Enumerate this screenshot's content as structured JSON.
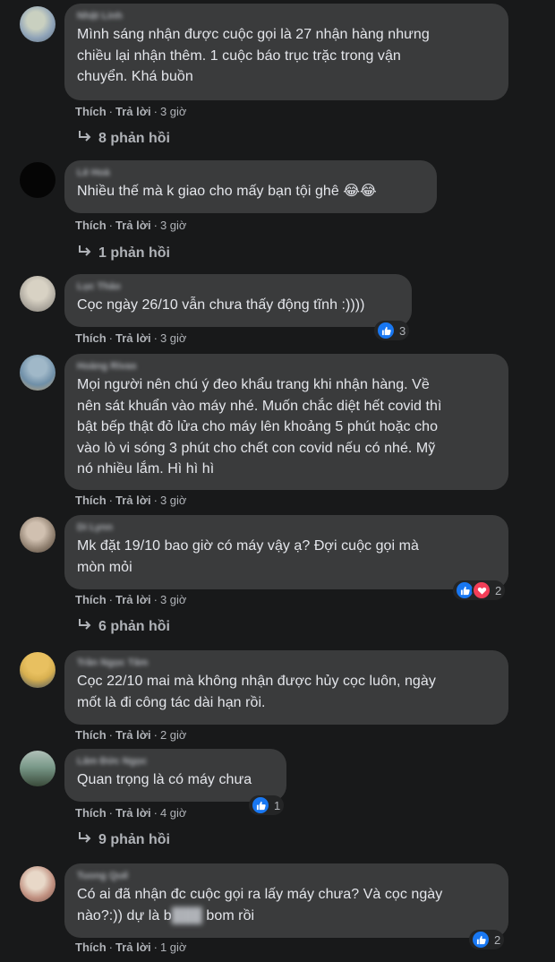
{
  "comments": [
    {
      "author": "Nhật Linh",
      "text": "Mình sáng nhận được cuộc gọi là 27 nhận hàng nhưng\nchiều lại nhận thêm. 1 cuộc báo trục trặc trong vận\nchuyển. Khá buồn",
      "like": "Thích",
      "reply": "Trả lời",
      "time": "3 giờ",
      "replies": "8 phản hồi",
      "avatar_colors": [
        "#8fa3b8",
        "#c9d0c0"
      ]
    },
    {
      "author": "Lê Hoà",
      "text": "Nhiều thế mà k giao cho mấy bạn tội ghê 😂😂",
      "like": "Thích",
      "reply": "Trả lời",
      "time": "3 giờ",
      "replies": "1 phản hồi",
      "avatar_colors": [
        "#050505",
        "#0a0a0a"
      ]
    },
    {
      "author": "Lục Thảo",
      "text": "Cọc ngày 26/10 vẫn chưa thấy động tĩnh :))))",
      "like": "Thích",
      "reply": "Trả lời",
      "time": "3 giờ",
      "reaction_count": "3",
      "avatar_colors": [
        "#a8a39a",
        "#d8d2c4"
      ]
    },
    {
      "author": "Hoàng Rivas",
      "text": "Mọi người nên chú ý đeo khẩu trang khi nhận hàng. Về\nnên sát khuẩn vào máy nhé. Muốn chắc diệt hết covid thì\nbật bếp thật đỏ lửa cho máy lên khoảng 5 phút hoặc cho\nvào lò vi sóng 3 phút cho chết con covid nếu có nhé. Mỹ\nnó nhiều lắm. Hì hì hì",
      "like": "Thích",
      "reply": "Trả lời",
      "time": "3 giờ",
      "avatar_colors": [
        "#6f8fa8",
        "#c0a070"
      ]
    },
    {
      "author": "Di Lynn",
      "text": "Mk đặt 19/10 bao giờ có máy vậy ạ? Đợi cuộc gọi mà\nmòn mỏi",
      "like": "Thích",
      "reply": "Trả lời",
      "time": "3 giờ",
      "reaction_count": "2",
      "replies": "6 phản hồi",
      "avatar_colors": [
        "#8a7a6a",
        "#d0c0b0"
      ]
    },
    {
      "author": "Trần Ngọc Tâm",
      "text": "Cọc 22/10 mai mà không nhận được hủy cọc luôn, ngày\nmốt là đi công tác dài hạn rồi.",
      "like": "Thích",
      "reply": "Trả lời",
      "time": "2 giờ",
      "avatar_colors": [
        "#d8b050",
        "#405060"
      ]
    },
    {
      "author": "Lâm Đức Ngọc",
      "text": "Quan trọng là có máy chưa",
      "like": "Thích",
      "reply": "Trả lời",
      "time": "4 giờ",
      "reaction_count": "1",
      "replies": "9 phản hồi",
      "avatar_colors": [
        "#7a9a8a",
        "#3a4a3a"
      ]
    },
    {
      "author": "Tuong Quế",
      "text": "Có ai đã nhận đc cuộc gọi ra lấy máy chưa? Và cọc ngày\nnào?:)) dự là b",
      "text_tail": " bom rồi",
      "like": "Thích",
      "reply": "Trả lời",
      "time": "1 giờ",
      "reaction_count": "2",
      "avatar_colors": [
        "#c09080",
        "#e8d8c8"
      ]
    }
  ],
  "icons": {
    "reply_arrow": "reply-arrow-icon",
    "like": "like-reaction-icon",
    "love": "love-reaction-icon"
  },
  "colors": {
    "background": "#18191a",
    "bubble": "#3a3b3c",
    "text": "#e4e6eb",
    "secondary": "#b0b3b8",
    "like_blue": "#1877f2",
    "love_red": "#f33e58"
  }
}
